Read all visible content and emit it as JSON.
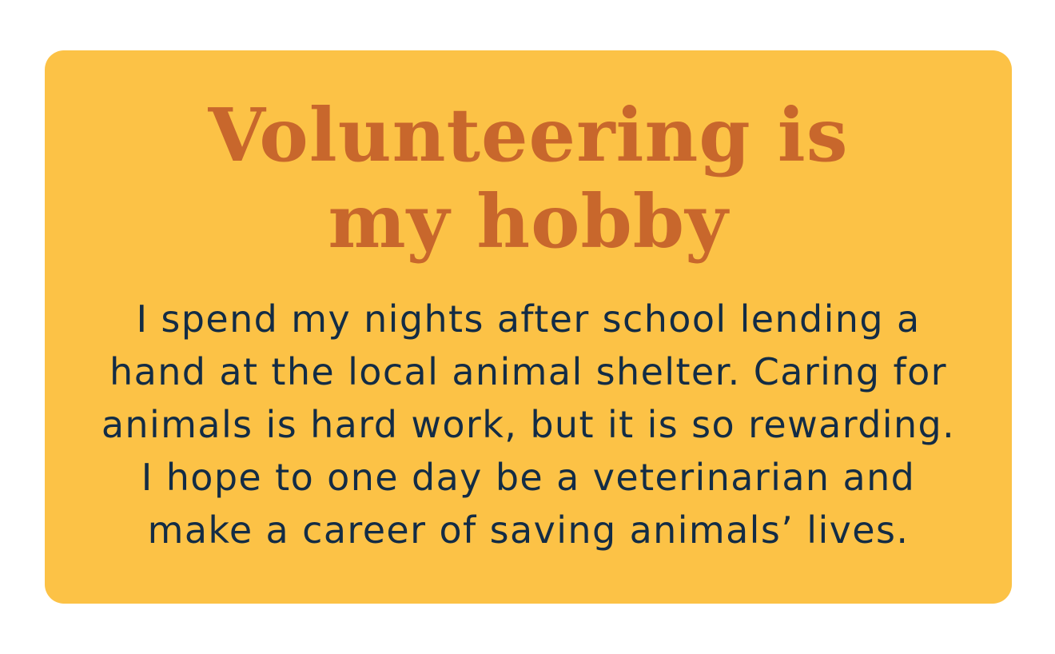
{
  "card": {
    "background_color": "#fcc246",
    "title_color": "#c8672c",
    "text_color": "#132c45",
    "title_lines": [
      "Volunteering is",
      "my hobby"
    ],
    "body_lines": [
      "I spend my nights after school lending a",
      "hand at the local animal shelter. Caring for",
      "animals is hard work, but it is so rewarding.",
      "I hope to one day be a veterinarian and",
      "make a career of saving animals’ lives."
    ]
  }
}
